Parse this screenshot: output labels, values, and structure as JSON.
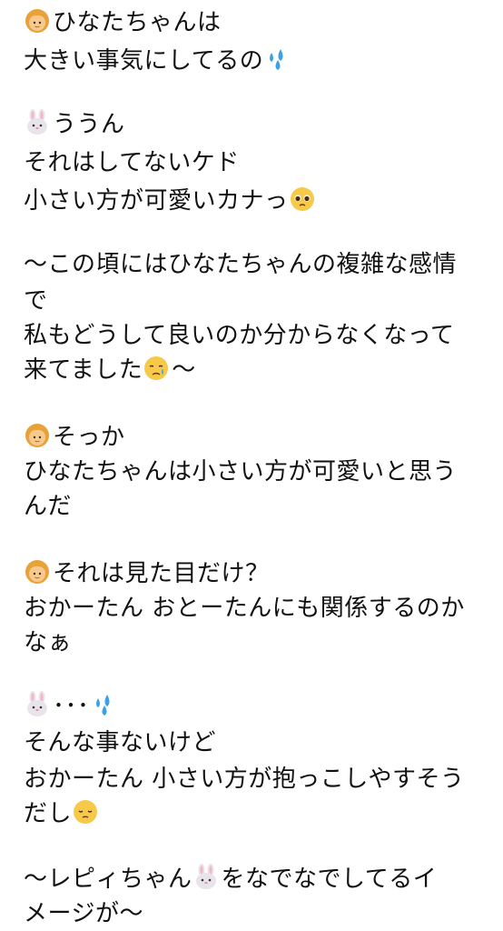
{
  "post": {
    "lines": [
      {
        "emoji": "person-emoji",
        "text": "ひなたちゃんは"
      },
      {
        "text": "大きい事気にしてるの",
        "emoji_after": "sweat-droplets-emoji"
      },
      {
        "emoji": "rabbit-face-emoji",
        "text": "ううん"
      },
      {
        "text": "それはしてないケド"
      },
      {
        "text": "小さい方が可愛いカナっ",
        "emoji_after": "pleading-face-emoji"
      },
      {
        "text": "〜この頃にはひなたちゃんの複雑な感情"
      },
      {
        "text": "で"
      },
      {
        "text": "私もどうして良いのか分からなくなって"
      },
      {
        "text": "来てました",
        "emoji_after": "sad-relieved-face-emoji",
        "text_after": "〜"
      },
      {
        "emoji": "person-emoji",
        "text": "そっか"
      },
      {
        "text": "ひなたちゃんは小さい方が可愛いと思う"
      },
      {
        "text": "んだ"
      },
      {
        "emoji": "person-emoji",
        "text": "それは見た目だけ？"
      },
      {
        "text": "おかーたん おとーたんにも関係するのか"
      },
      {
        "text": "なぁ"
      },
      {
        "emoji": "rabbit-face-emoji",
        "text": "･･･",
        "emoji_after": "sweat-droplets-emoji"
      },
      {
        "text": "そんな事ないけど"
      },
      {
        "text": "おかーたん 小さい方が抱っこしやすそう"
      },
      {
        "text": "だし",
        "emoji_after": "pensive-face-emoji"
      },
      {
        "text": "〜レピィちゃん",
        "emoji_after": "rabbit-face-emoji",
        "text_after": "をなでなでしてるイ"
      },
      {
        "text": "メージが〜"
      }
    ]
  }
}
